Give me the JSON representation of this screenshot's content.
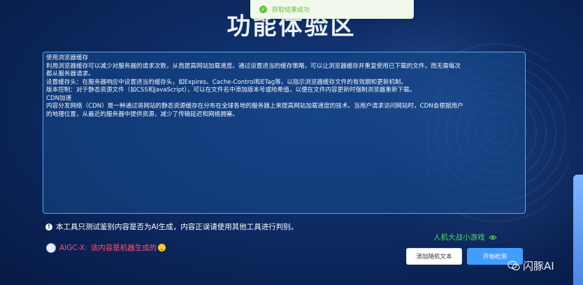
{
  "page": {
    "title": "功能体验区"
  },
  "toast": {
    "icon": "check-circle-icon",
    "text": "获取结果成功"
  },
  "editor": {
    "lines": [
      "使用浏览器缓存",
      "利用浏览器缓存可以减少对服务器的请求次数，从而提高网站加载速度。通过设置适当的缓存策略，可以让浏览器缓存并重复使用已下载的文件，而无需每次",
      "都从服务器请求。",
      "设置缓存头：在服务器响应中设置适当的缓存头，如Expires、Cache-Control和ETag等，以指示浏览器缓存文件的有效期和更新机制。",
      "版本控制：对于静态资源文件（如CSS和JavaScript），可以在文件名中添加版本号或哈希值，以便在文件内容更新时强制浏览器重新下载。",
      "CDN加速",
      "内容分发网络（CDN）是一种通过将网站的静态资源缓存在分布在全球各地的服务器上来提高网站加载速度的技术。当用户请求访问网站时，CDN会根据用户",
      "的地理位置，从最近的服务器中提供资源，减少了传输延迟和网络拥塞。"
    ]
  },
  "disclaimer": {
    "icon": "info-circle-icon",
    "text": "本工具只测试鉴别内容是否为AI生成，内容正误请使用其他工具进行判别。"
  },
  "mini_game": {
    "label": "人机大战小游戏",
    "icon": "eye-icon"
  },
  "result": {
    "prefix": "AIGC-X:",
    "text": "该内容是机器生成的",
    "emoji": "smile-icon"
  },
  "buttons": {
    "add_sample": "添加随机文本",
    "start_detect": "开始检测"
  },
  "watermark": {
    "text": "闪豚AI",
    "icon": "wechat-icon"
  },
  "colors": {
    "background": "#0d2b63",
    "editor_border": "#57a8f0",
    "toast_green": "#67c23a",
    "game_green": "#4cd964",
    "result_red": "#ff4f7a",
    "primary_blue": "#409eff"
  }
}
